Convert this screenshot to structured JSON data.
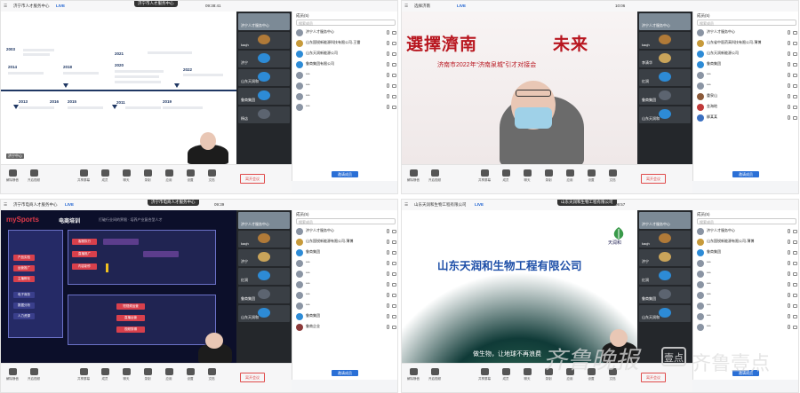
{
  "common": {
    "live_label": "LIVE",
    "participants_title": "成员(5)",
    "search_placeholder": "搜索成员",
    "invite_label": "邀请成员",
    "leave_label": "离开会议",
    "toolbar_items": [
      "解除静音",
      "开启视频",
      "共享屏幕",
      "成员",
      "聊天",
      "录制",
      "应用",
      "设置",
      "文档"
    ]
  },
  "q1": {
    "meeting_title": "济宁市人才服务中心",
    "record_time": "09:38:41",
    "years": [
      "2003",
      "2014",
      "2018",
      "2021",
      "2013",
      "2015",
      "2019",
      "2020",
      "2011",
      "2016",
      "2022"
    ],
    "self_label": "济宁中心",
    "tiles": [
      "济宁人才服务中心",
      "kaqh",
      "济宁",
      "山东天润和",
      "鲁商集团",
      "杨店"
    ],
    "participants": [
      "济宁人才服务中心",
      "山东国锐新能源科技有限公司-王雷",
      "山东天润新能源公司",
      "鲁商集团有限公司",
      "***",
      "***",
      "***",
      "***"
    ]
  },
  "q2": {
    "meeting_title": "选择济南",
    "banner_title": "選擇濟南",
    "banner_title2": "未来",
    "banner_sub": "济南市2022年“济南泉城”引才对接会",
    "record_time": "10:06",
    "tiles": [
      "济宁人才服务中心",
      "kaqh",
      "李清华",
      "红润",
      "鲁商集团",
      "山东天润和"
    ],
    "participants": [
      "济宁人才服务中心",
      "山东省中医药高科技有限公司-薄博",
      "山东天润新能源公司",
      "鲁商集团",
      "***",
      "***",
      "重泉山",
      "金海地",
      "柳某某"
    ]
  },
  "q3": {
    "meeting_title": "济宁市电商人才服务中心",
    "record_time": "09:39",
    "brand": "mySports",
    "slide_title": "电商培训",
    "slide_sub": "打破行业间的界限 · 培养产业复合型人才",
    "left_items": [
      "产品实验",
      "运营推广",
      "主播孵化",
      "电子商务",
      "数据分析",
      "人力资源"
    ],
    "mid_items": [
      "客服执行",
      "直播推广",
      "内容制作"
    ],
    "right_items": [
      "短视频运营",
      "直播运营",
      "视频剪辑"
    ],
    "tiles": [
      "济宁人才服务中心",
      "kaqh",
      "济宁",
      "红润",
      "鲁商集团",
      "山东天润和"
    ],
    "participants": [
      "济宁人才服务中心",
      "山东国锐新能源有限公司-薄博",
      "鲁商集团",
      "***",
      "***",
      "***",
      "***",
      "***",
      "鲁商集团",
      "鲁商企业"
    ]
  },
  "q4": {
    "meeting_title": "山东天润和生物工程有限公司",
    "record_time": "09:57",
    "company_name": "山东天润和生物工程有限公司",
    "logo_text": "天润和",
    "slogan": "做生物，让地球不再浪费",
    "tiles": [
      "济宁人才服务中心",
      "kaqh",
      "济宁",
      "红润",
      "鲁商集团",
      "山东天润和"
    ],
    "participants": [
      "济宁人才服务中心",
      "山东国锐新能源有限公司-薄博",
      "鲁商集团",
      "***",
      "***",
      "***",
      "***",
      "***",
      "***",
      "***"
    ]
  },
  "watermark": {
    "brand": "齐鲁晚报",
    "badge": "壹点",
    "right": "齐鲁壹点"
  }
}
